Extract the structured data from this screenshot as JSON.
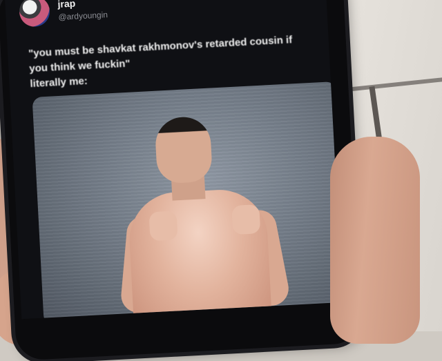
{
  "tweet": {
    "display_name": "jrap",
    "handle": "@ardyoungin",
    "text_lines": [
      "\"you must be shavkat rakhmonov's retarded cousin if",
      "you think we fuckin\"",
      "literally me:"
    ]
  },
  "icons": {
    "avatar": "profile-avatar"
  },
  "colors": {
    "screen_background": "#0f1014",
    "text_primary": "#f0f0f0",
    "text_secondary": "#8b8d93"
  }
}
